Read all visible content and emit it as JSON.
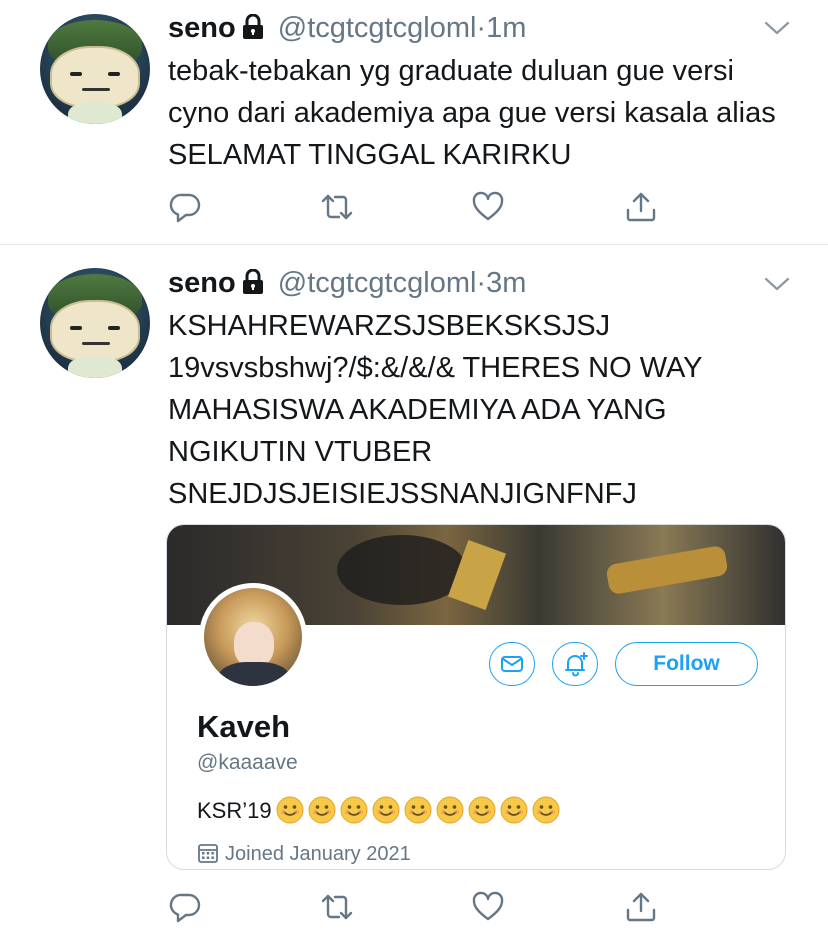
{
  "tweets": [
    {
      "name": "seno",
      "handle": "@tcgtcgtcgloml",
      "time": "1m",
      "text": "tebak-tebakan yg graduate duluan gue versi cyno dari akademiya apa gue versi kasala alias SELAMAT TINGGAL KARIRKU"
    },
    {
      "name": "seno",
      "handle": "@tcgtcgtcgloml",
      "time": "3m",
      "text": "KSHAHREWARZSJSBEKSKSJSJ\n19vsvsbshwj?/$:&/&/& THERES NO WAY MAHASISWA AKADEMIYA ADA YANG NGIKUTIN VTUBER\nSNEJDJSJEISIEJSSNANJIGNFNFJ",
      "card": {
        "name": "Kaveh",
        "handle": "@kaaaave",
        "bio": "KSR’19",
        "emoji_count": 9,
        "joined": "Joined January 2021",
        "follow_label": "Follow"
      }
    }
  ],
  "separator": "·",
  "colors": {
    "accent": "#1da1f2",
    "secondary_text": "#657786",
    "divider": "#e1e8ed"
  },
  "icons": [
    "lock-icon",
    "chevron-down-icon",
    "reply-icon",
    "retweet-icon",
    "like-icon",
    "share-icon",
    "message-icon",
    "bell-plus-icon",
    "calendar-icon",
    "smile-emoji"
  ]
}
